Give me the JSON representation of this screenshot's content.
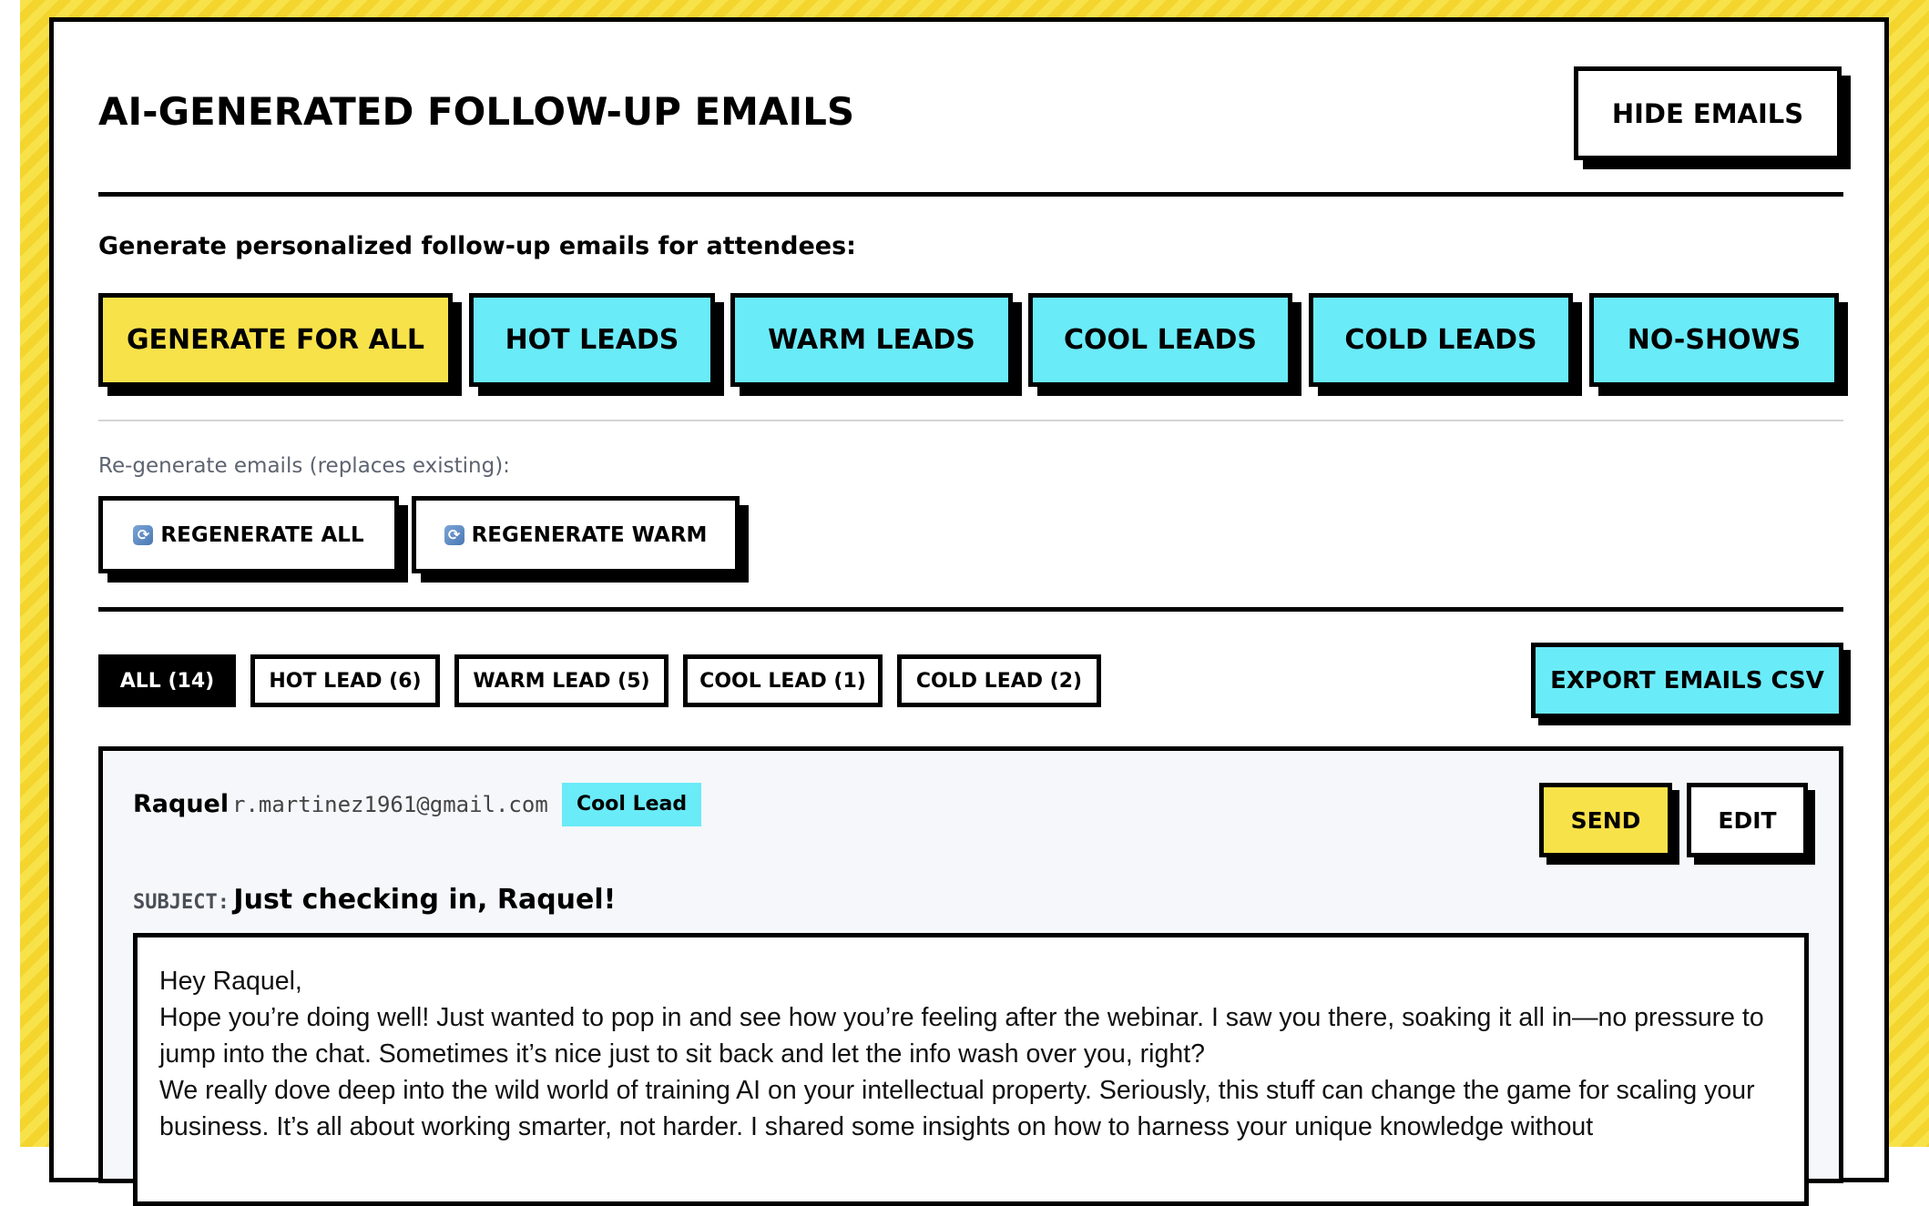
{
  "header": {
    "title": "AI-GENERATED FOLLOW-UP EMAILS",
    "hide_button": "HIDE EMAILS"
  },
  "generate": {
    "prompt": "Generate personalized follow-up emails for attendees:",
    "buttons": [
      "GENERATE FOR ALL",
      "HOT LEADS",
      "WARM LEADS",
      "COOL LEADS",
      "COLD LEADS",
      "NO-SHOWS"
    ]
  },
  "regenerate": {
    "prompt": "Re-generate emails (replaces existing):",
    "icon": "refresh-icon",
    "buttons": [
      "REGENERATE ALL",
      "REGENERATE WARM"
    ]
  },
  "filters": {
    "tabs": [
      "ALL (14)",
      "HOT LEAD (6)",
      "WARM LEAD (5)",
      "COOL LEAD (1)",
      "COLD LEAD (2)"
    ],
    "active": "ALL (14)",
    "export_button": "EXPORT EMAILS CSV"
  },
  "email": {
    "name": "Raquel",
    "address": "r.martinez1961@gmail.com",
    "badge": "Cool Lead",
    "send_button": "SEND",
    "edit_button": "EDIT",
    "subject_label": "SUBJECT:",
    "subject": "Just checking in, Raquel!",
    "body": [
      "Hey Raquel,",
      "Hope you’re doing well! Just wanted to pop in and see how you’re feeling after the webinar. I saw you there, soaking it all in—no pressure to jump into the chat. Sometimes it’s nice just to sit back and let the info wash over you, right?",
      "We really dove deep into the wild world of training AI on your intellectual property. Seriously, this stuff can change the game for scaling your business. It’s all about working smarter, not harder. I shared some insights on how to harness your unique knowledge without"
    ]
  },
  "colors": {
    "yellow": "#f8e24a",
    "cyan": "#6aebf8",
    "card_bg": "#f6f7fa",
    "muted_text": "#5d6470"
  }
}
